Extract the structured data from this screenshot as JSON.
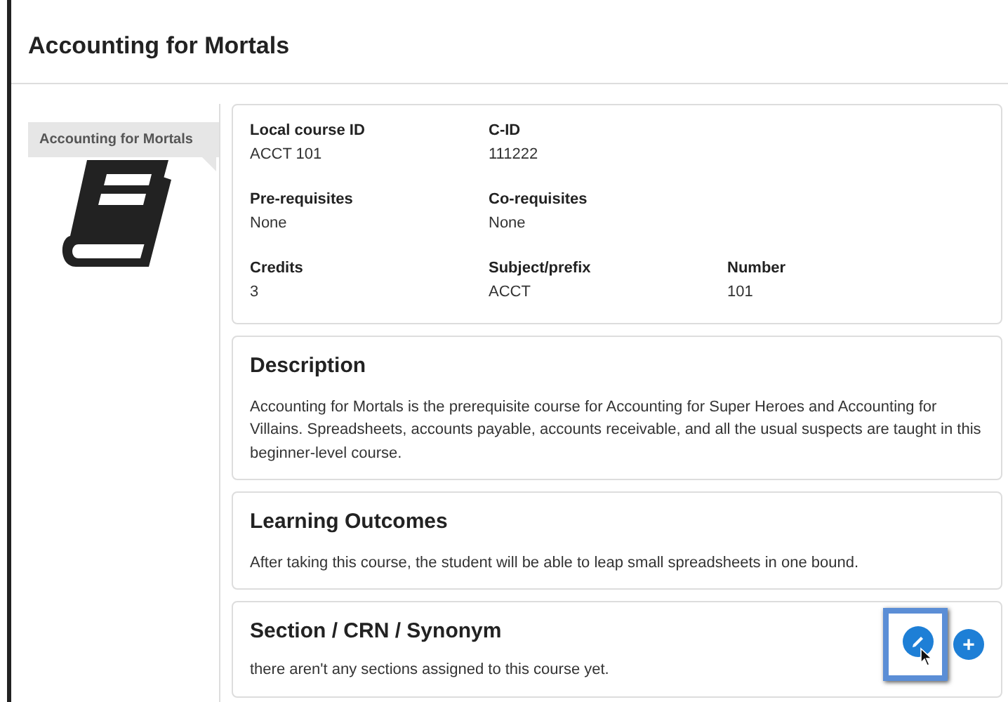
{
  "header": {
    "title": "Accounting for Mortals"
  },
  "sidebar": {
    "ribbon": "Accounting for Mortals"
  },
  "details": {
    "rows": [
      [
        {
          "label": "Local course ID",
          "value": "ACCT 101"
        },
        {
          "label": "C-ID",
          "value": "111222"
        }
      ],
      [
        {
          "label": "Pre-requisites",
          "value": "None"
        },
        {
          "label": "Co-requisites",
          "value": "None"
        }
      ],
      [
        {
          "label": "Credits",
          "value": "3"
        },
        {
          "label": "Subject/prefix",
          "value": "ACCT"
        },
        {
          "label": "Number",
          "value": "101"
        }
      ]
    ]
  },
  "sections": [
    {
      "title": "Description",
      "text": "Accounting for Mortals is the prerequisite course for Accounting for Super Heroes and Accounting for Villains. Spreadsheets, accounts payable, accounts receivable, and all the usual suspects are taught in this beginner-level course."
    },
    {
      "title": "Learning Outcomes",
      "text": "After taking this course, the student will be able to leap small spreadsheets in one bound."
    },
    {
      "title": "Section / CRN / Synonym",
      "text": "there aren't any sections assigned to this course yet.",
      "actions": [
        {
          "kind": "edit",
          "highlighted": true
        },
        {
          "kind": "add",
          "label": "+",
          "highlighted": false
        }
      ]
    }
  ]
}
